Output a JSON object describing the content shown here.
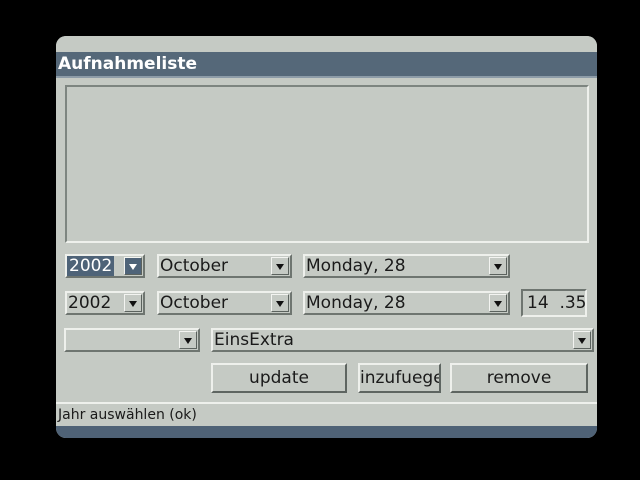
{
  "window": {
    "title": "Aufnahmeliste",
    "colors": {
      "titlebar": "#556879",
      "background": "#c5cac4",
      "selected": "#4e6378"
    }
  },
  "recording_list": {
    "items": []
  },
  "start_row": {
    "year": "2002",
    "month": "October",
    "day": "Monday, 28"
  },
  "end_row": {
    "year": "2002",
    "month": "October",
    "day": "Monday, 28",
    "time": "14  .35"
  },
  "channel_row": {
    "type": "",
    "channel": "EinsExtra"
  },
  "buttons": {
    "update": "update",
    "add": "inzufuege",
    "remove": "remove"
  },
  "status": {
    "text": "Jahr auswählen (ok)"
  }
}
